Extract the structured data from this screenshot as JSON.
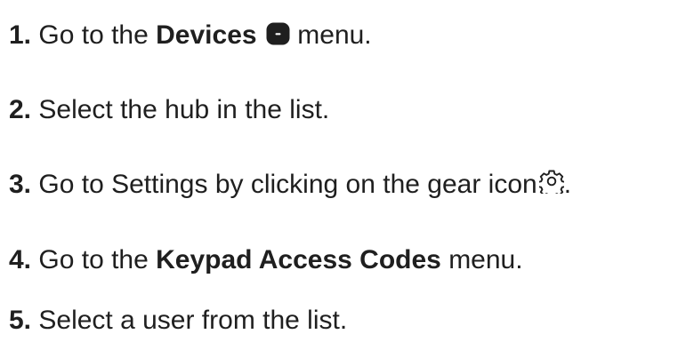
{
  "steps": [
    {
      "number": "1.",
      "text_before": "Go to the",
      "bold": "Devices",
      "icon": "devices-icon",
      "text_after": "menu."
    },
    {
      "number": "2.",
      "text": "Select the hub in the list."
    },
    {
      "number": "3.",
      "text": "Go to Settings by clicking on the gear icon",
      "icon": "gear-icon",
      "text_after": "."
    },
    {
      "number": "4.",
      "text_before": "Go to the",
      "bold": "Keypad Access Codes",
      "text_after": "menu."
    },
    {
      "number": "5.",
      "text": "Select a user from the list."
    }
  ]
}
